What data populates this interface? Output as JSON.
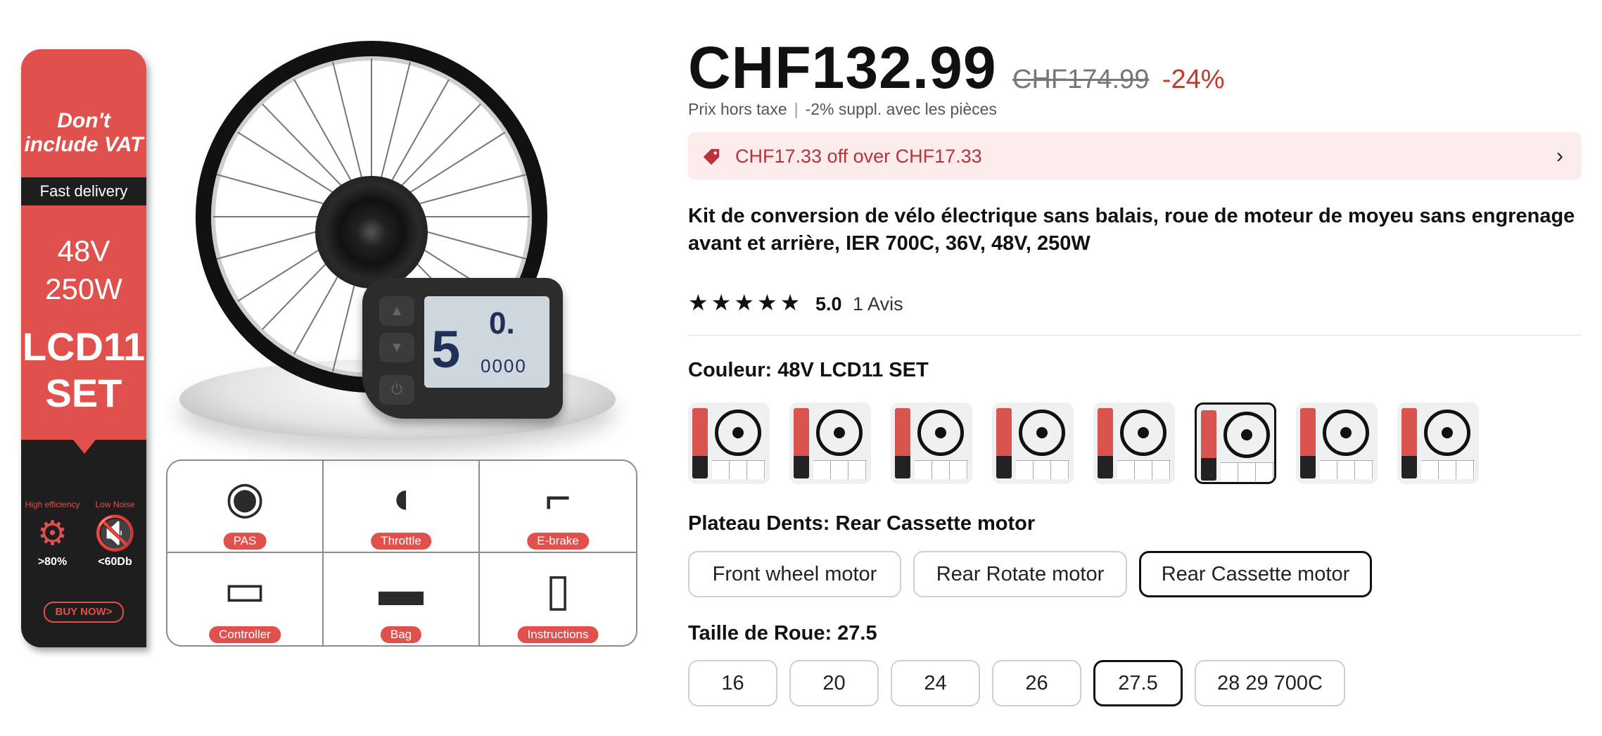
{
  "media": {
    "banner": {
      "vat_line1": "Don't",
      "vat_line2": "include VAT",
      "fast_delivery": "Fast delivery",
      "voltage": "48V",
      "power": "250W",
      "model_line1": "LCD11",
      "model_line2": "SET",
      "feature1_label": "High efficiency",
      "feature1_value": ">80%",
      "feature2_label": "Low Noise",
      "feature2_value": "<60Db",
      "buy_now": "BUY NOW>"
    },
    "display": {
      "gear": "5",
      "speed": "0.",
      "odometer": "0000"
    },
    "accessories": [
      "PAS",
      "Throttle",
      "E-brake",
      "Controller",
      "Bag",
      "Instructions"
    ]
  },
  "price": {
    "current": "CHF132.99",
    "original": "CHF174.99",
    "discount": "-24%"
  },
  "tax": {
    "note": "Prix hors taxe",
    "extra": "-2% suppl. avec les pièces"
  },
  "coupon": {
    "text": "CHF17.33 off over CHF17.33",
    "icon": "tag-icon",
    "chevron": "chevron-right-icon"
  },
  "product": {
    "title": "Kit de conversion de vélo électrique sans balais, roue de moteur de moyeu sans engrenage avant et arrière, IER 700C, 36V, 48V, 250W"
  },
  "rating": {
    "stars": "★★★★★",
    "score": "5.0",
    "count": "1 Avis"
  },
  "color_option": {
    "label": "Couleur:",
    "value": "48V LCD11 SET",
    "selected_index": 5,
    "thumb_count": 8
  },
  "gear_option": {
    "label": "Plateau Dents:",
    "value": "Rear Cassette motor",
    "choices": [
      "Front wheel motor",
      "Rear Rotate motor",
      "Rear Cassette motor"
    ],
    "selected_index": 2
  },
  "wheel_option": {
    "label": "Taille de Roue:",
    "value": "27.5",
    "choices": [
      "16",
      "20",
      "24",
      "26",
      "27.5",
      "28 29 700C"
    ],
    "selected_index": 4
  },
  "colors": {
    "accent_red": "#e0504c",
    "discount_red": "#c0392b",
    "coupon_bg": "#fdecec",
    "coupon_text": "#b8333a"
  }
}
